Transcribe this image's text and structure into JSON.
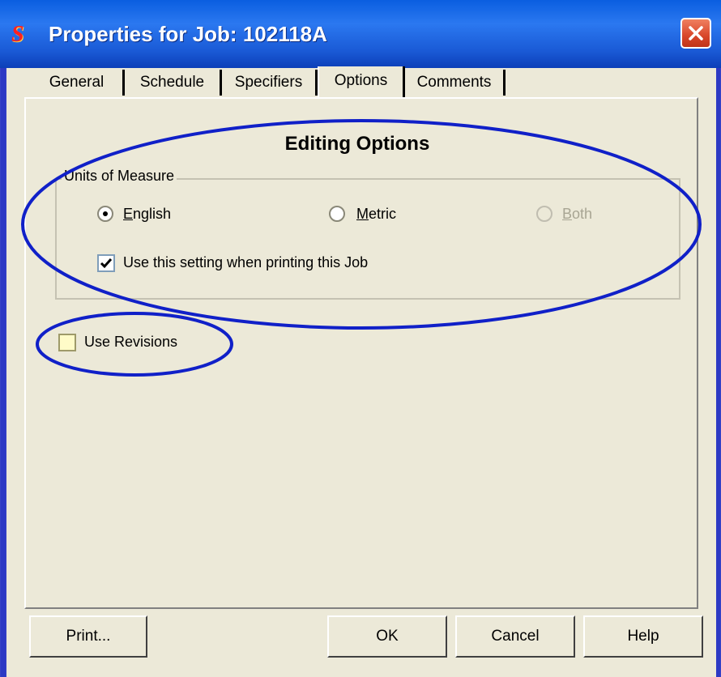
{
  "window": {
    "title": "Properties for Job: 102118A",
    "app_icon_text": "S"
  },
  "tabs": [
    {
      "label": "General",
      "active": false
    },
    {
      "label": "Schedule",
      "active": false
    },
    {
      "label": "Specifiers",
      "active": false
    },
    {
      "label": "Options",
      "active": true
    },
    {
      "label": "Comments",
      "active": false
    }
  ],
  "options": {
    "heading": "Editing Options",
    "units_group": {
      "label": "Units of Measure",
      "radios": [
        {
          "mnemonic": "E",
          "rest": "nglish",
          "selected": true,
          "enabled": true
        },
        {
          "mnemonic": "M",
          "rest": "etric",
          "selected": false,
          "enabled": true
        },
        {
          "mnemonic": "B",
          "rest": "oth",
          "selected": false,
          "enabled": false
        }
      ],
      "print_setting": {
        "label": "Use this setting when printing this Job",
        "checked": true
      }
    },
    "use_revisions": {
      "label": "Use Revisions",
      "checked": false
    }
  },
  "buttons": {
    "print": "Print...",
    "ok": "OK",
    "cancel": "Cancel",
    "help": "Help"
  },
  "colors": {
    "annotation": "#1020c8",
    "titlebar": "#2b78f0",
    "dialog_bg": "#ece9d8",
    "close": "#d8462a"
  }
}
